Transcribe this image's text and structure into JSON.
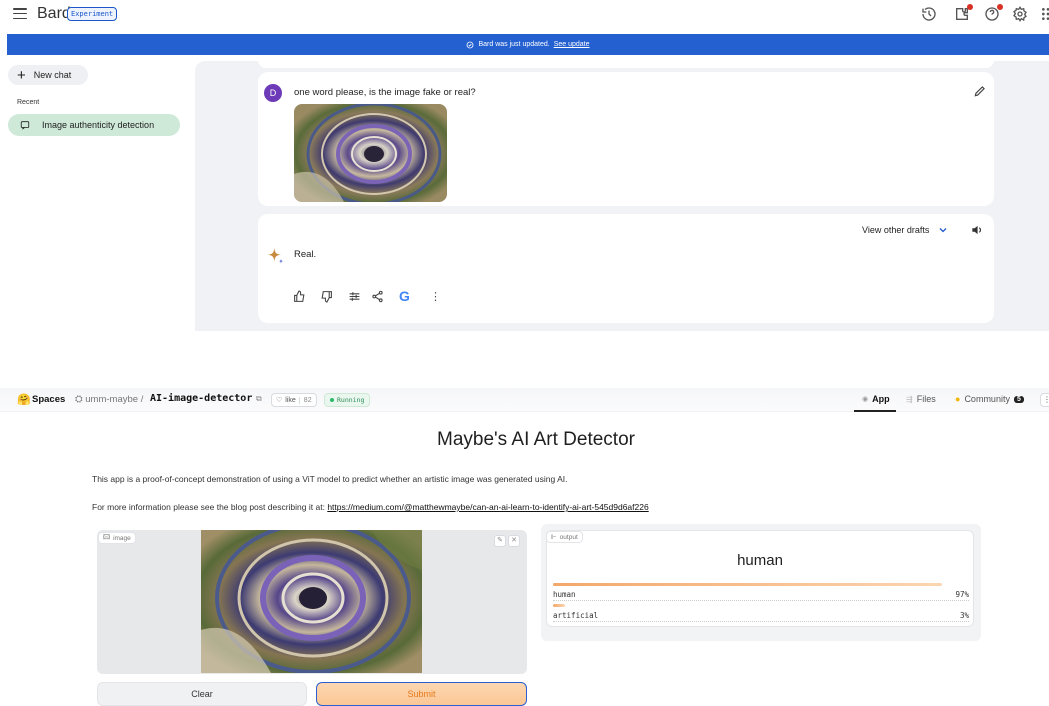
{
  "bard": {
    "title": "Bard",
    "badge": "Experiment",
    "banner": {
      "text": "Bard was just updated.",
      "link": "See update"
    },
    "sidebar": {
      "new_chat": "New chat",
      "recent_label": "Recent",
      "chats": [
        "Image authenticity detection"
      ]
    },
    "conversation": {
      "user_initial": "D",
      "user_message": "one word please, is the image fake or real?",
      "view_drafts": "View other drafts",
      "reply": "Real."
    },
    "colors": {
      "banner": "#2460d0",
      "avatar": "#6e3bb8",
      "active_chat": "#cfe9d9",
      "main_bg": "#f0f2f6"
    },
    "icons": [
      "history-icon",
      "extensions-icon",
      "help-icon",
      "settings-icon",
      "apps-icon",
      "edit-icon",
      "speaker-icon",
      "thumbs-up-icon",
      "thumbs-down-icon",
      "modify-response-icon",
      "share-icon",
      "google-icon",
      "more-icon"
    ]
  },
  "spaces": {
    "brand": "Spaces",
    "owner": "umm-maybe",
    "separator": "/",
    "repo": "AI-image-detector",
    "like_label": "like",
    "like_count": "82",
    "status": "Running",
    "tabs": {
      "app": "App",
      "files": "Files",
      "community": "Community",
      "community_count": "5"
    }
  },
  "app": {
    "title": "Maybe's AI Art Detector",
    "description": "This app is a proof-of-concept demonstration of using a ViT model to predict whether an artistic image was generated using AI.",
    "more_info_prefix": "For more information please see the blog post describing it at:",
    "more_info_link": "https://medium.com/@matthewmaybe/can-an-ai-learn-to-identify-ai-art-545d9d6af226",
    "image_label": "image",
    "clear_label": "Clear",
    "submit_label": "Submit",
    "output": {
      "label": "output",
      "top_label": "human",
      "confidences": [
        {
          "label": "human",
          "percent": "97%",
          "value": 0.97
        },
        {
          "label": "artificial",
          "percent": "3%",
          "value": 0.03
        }
      ]
    }
  }
}
